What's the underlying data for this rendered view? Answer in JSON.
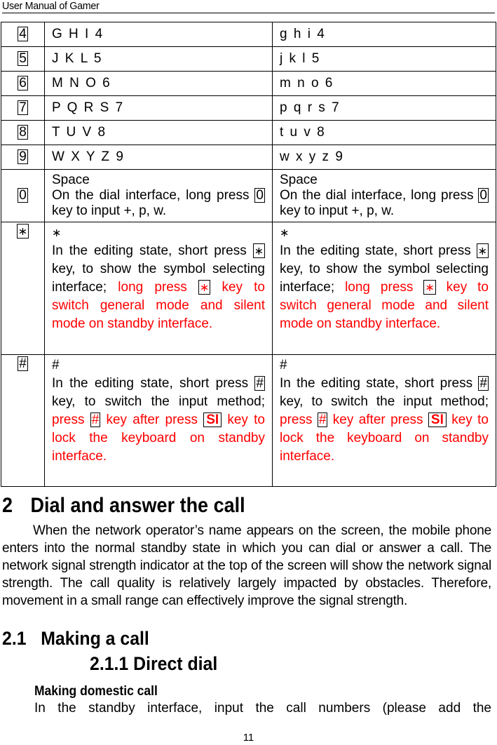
{
  "header": {
    "title": "User Manual of Gamer"
  },
  "key_table": {
    "simple_rows": [
      {
        "key": "4",
        "upper": "G H I 4",
        "lower": "g h i 4"
      },
      {
        "key": "5",
        "upper": "J K L 5",
        "lower": "j k l 5"
      },
      {
        "key": "6",
        "upper": "M N O 6",
        "lower": "m n o 6"
      },
      {
        "key": "7",
        "upper": "P Q R S 7",
        "lower": "p q r s 7"
      },
      {
        "key": "8",
        "upper": "T U V 8",
        "lower": "t u v 8"
      },
      {
        "key": "9",
        "upper": "W X Y Z 9",
        "lower": "w x y z 9"
      }
    ],
    "zero_row": {
      "key": "0",
      "title": "Space",
      "text_before": "On the dial interface, long press ",
      "key_ref": "0",
      "text_after": " key to input +, p, w."
    },
    "star_row": {
      "key": "∗",
      "title": "∗",
      "text_1": "In the editing state, short press ",
      "key_ref": "∗",
      "text_2": " key, to show the symbol selecting interface; ",
      "red_1": "long press ",
      "red_2": " key to switch general mode and silent mode on standby interface."
    },
    "hash_row": {
      "key": "#",
      "title": "#",
      "text_1": "In the editing state, short press ",
      "key_ref": "#",
      "text_2": " key, to switch the input method; ",
      "red_1": "press ",
      "red_2": " key after press ",
      "lock_key": "SI",
      "red_3": " key to lock the keyboard on standby interface."
    }
  },
  "section_2": {
    "number": "2",
    "title": "Dial and answer the call",
    "paragraph": "When the network operator’s name appears on the screen, the mobile phone enters into the normal standby state in which you can dial or answer a call. The network signal strength indicator at the top of the screen will show the network signal strength. The call quality is relatively largely impacted by obstacles. Therefore, movement in a small range can effectively improve the signal strength."
  },
  "section_2_1": {
    "number": "2.1",
    "title": "Making a call"
  },
  "section_2_1_1": {
    "title": "2.1.1 Direct dial"
  },
  "subheading": "Making domestic call",
  "paragraph_2": "In the standby interface, input the call numbers (please add the",
  "footer": {
    "page_number": "11"
  },
  "colors": {
    "highlight_red": "#ff0000",
    "text": "#000000"
  }
}
